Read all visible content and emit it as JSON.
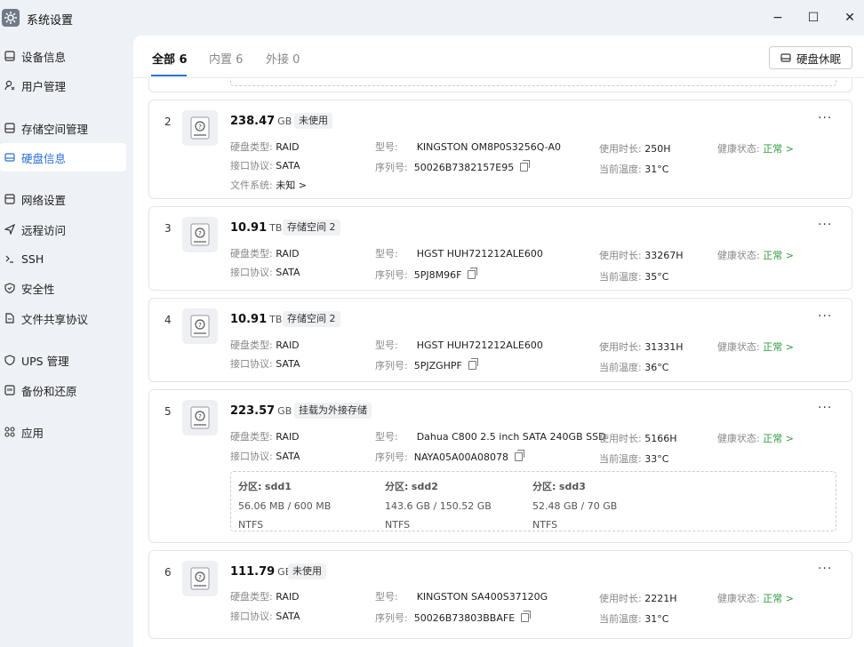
{
  "window": {
    "title": "系统设置",
    "minimize": "−",
    "maximize": "☐",
    "close": "✕"
  },
  "sidebar": {
    "items": [
      {
        "label": "设备信息",
        "icon": "device-icon"
      },
      {
        "label": "用户管理",
        "icon": "user-icon"
      },
      {
        "label": "存储空间管理",
        "icon": "storage-icon"
      },
      {
        "label": "硬盘信息",
        "icon": "disk-icon"
      },
      {
        "label": "网络设置",
        "icon": "network-icon"
      },
      {
        "label": "远程访问",
        "icon": "remote-icon"
      },
      {
        "label": "SSH",
        "icon": "terminal-icon"
      },
      {
        "label": "安全性",
        "icon": "shield-icon"
      },
      {
        "label": "文件共享协议",
        "icon": "file-icon"
      },
      {
        "label": "UPS 管理",
        "icon": "ups-icon"
      },
      {
        "label": "备份和还原",
        "icon": "backup-icon"
      },
      {
        "label": "应用",
        "icon": "apps-icon"
      }
    ],
    "active": "硬盘信息"
  },
  "tabs": [
    {
      "label": "全部 6",
      "active": true
    },
    {
      "label": "内置 6",
      "active": false
    },
    {
      "label": "外接 0",
      "active": false
    }
  ],
  "toolbar": {
    "sleep_label": "硬盘休眠"
  },
  "labels": {
    "disk_type": "硬盘类型:",
    "interface": "接口协议:",
    "filesystem": "文件系统:",
    "model": "型号:",
    "serial": "序列号:",
    "uptime": "使用时长:",
    "temp": "当前温度:",
    "health": "健康状态:",
    "partition": "分区:"
  },
  "disks": [
    {
      "index": "2",
      "capacity": "238.47",
      "unit": "GB",
      "badge": "未使用",
      "type": "RAID",
      "interface": "SATA",
      "filesystem": "未知 >",
      "model": "KINGSTON OM8P0S3256Q-A0",
      "serial": "50026B7382157E95",
      "uptime": "250H",
      "temp": "31°C",
      "health": "正常 >"
    },
    {
      "index": "3",
      "capacity": "10.91",
      "unit": "TB",
      "badge": "存储空间 2",
      "type": "RAID",
      "interface": "SATA",
      "model": "HGST HUH721212ALE600",
      "serial": "5PJ8M96F",
      "uptime": "33267H",
      "temp": "35°C",
      "health": "正常 >"
    },
    {
      "index": "4",
      "capacity": "10.91",
      "unit": "TB",
      "badge": "存储空间 2",
      "type": "RAID",
      "interface": "SATA",
      "model": "HGST HUH721212ALE600",
      "serial": "5PJZGHPF",
      "uptime": "31331H",
      "temp": "36°C",
      "health": "正常 >"
    },
    {
      "index": "5",
      "capacity": "223.57",
      "unit": "GB",
      "badge": "挂载为外接存储",
      "type": "RAID",
      "interface": "SATA",
      "model": "Dahua C800 2.5 inch SATA 240GB SSD",
      "serial": "NAYA05A00A08078",
      "uptime": "5166H",
      "temp": "33°C",
      "health": "正常 >",
      "partitions": [
        {
          "name": "sdd1",
          "usage": "56.06 MB / 600 MB",
          "fs": "NTFS"
        },
        {
          "name": "sdd2",
          "usage": "143.6 GB / 150.52 GB",
          "fs": "NTFS"
        },
        {
          "name": "sdd3",
          "usage": "52.48 GB / 70 GB",
          "fs": "NTFS"
        }
      ]
    },
    {
      "index": "6",
      "capacity": "111.79",
      "unit": "GB",
      "badge": "未使用",
      "type": "RAID",
      "interface": "SATA",
      "model": "KINGSTON SA400S37120G",
      "serial": "50026B73803BBAFE",
      "uptime": "2221H",
      "temp": "31°C",
      "health": "正常 >"
    }
  ],
  "colors": {
    "accent": "#2b6fd6",
    "ok": "#2f9a3f"
  }
}
